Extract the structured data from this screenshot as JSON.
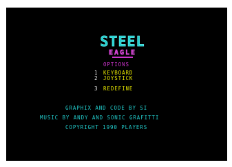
{
  "logo": {
    "line1": "STEEL",
    "line2": "EAGLE"
  },
  "menu": {
    "heading": "OPTIONS",
    "items": [
      {
        "number": "1",
        "label": "KEYBOARD"
      },
      {
        "number": "2",
        "label": "JOYSTICK"
      },
      {
        "number": "3",
        "label": "REDEFINE"
      }
    ]
  },
  "credits": {
    "graphics": "GRAPHIX AND CODE BY SI",
    "music": "MUSIC BY ANDY AND SONIC GRAFITTI",
    "copyright": "COPYRIGHT 1990 PLAYERS"
  },
  "colors": {
    "screen_bg": "#000000",
    "heading": "#cc33cc",
    "option_numbers": "#eeeeee",
    "option_labels": "#e8e800",
    "credits": "#22cccc",
    "logo_main": "#22cccc",
    "logo_accent": "#cc33cc"
  }
}
